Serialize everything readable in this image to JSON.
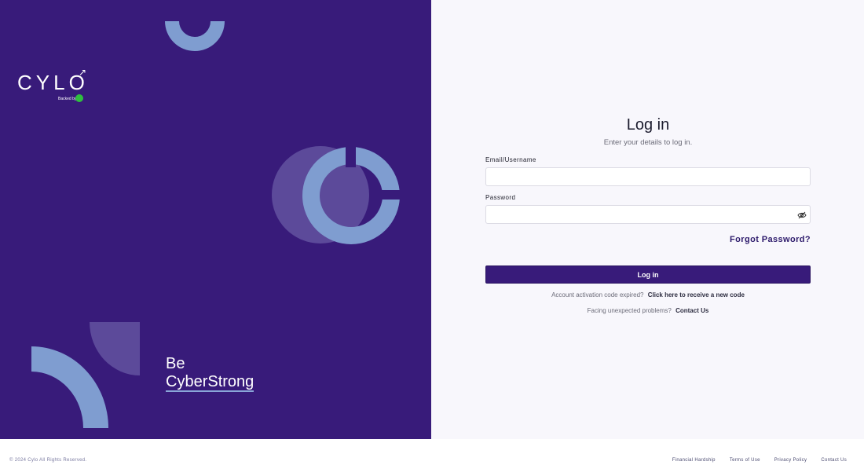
{
  "brand": {
    "logo_text": "CYLO",
    "backed_by": "Backed by",
    "tagline_line1": "Be",
    "tagline_line2": "CyberStrong"
  },
  "login": {
    "title": "Log in",
    "subtitle": "Enter your details to log in.",
    "email_label": "Email/Username",
    "email_value": "",
    "password_label": "Password",
    "password_value": "",
    "forgot_password": "Forgot Password?",
    "submit_label": "Log in",
    "activation_text": "Account activation code expired?",
    "activation_link": "Click here to receive a new code",
    "problems_text": "Facing unexpected problems?",
    "problems_link": "Contact Us"
  },
  "footer": {
    "copyright": "© 2024 Cylo All Rights Reserved.",
    "links": [
      "Financial Hardship",
      "Terms of Use",
      "Privacy Policy",
      "Contact Us"
    ]
  },
  "colors": {
    "brand_purple": "#381b7a",
    "accent_blue": "#7f9dd0",
    "form_background": "#f8f7fc"
  },
  "icons": {
    "password_toggle": "eye-off-icon",
    "logo_mark": "arrow-up-right-icon"
  }
}
